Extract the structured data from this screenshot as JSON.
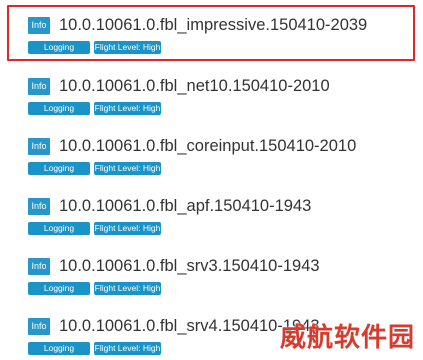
{
  "builds": [
    {
      "badge": "Info",
      "name": "10.0.10061.0.fbl_impressive.150410-2039",
      "tags": [
        "Logging",
        "Flight Level: High"
      ],
      "selected": true
    },
    {
      "badge": "Info",
      "name": "10.0.10061.0.fbl_net10.150410-2010",
      "tags": [
        "Logging",
        "Flight Level: High"
      ],
      "selected": false
    },
    {
      "badge": "Info",
      "name": "10.0.10061.0.fbl_coreinput.150410-2010",
      "tags": [
        "Logging",
        "Flight Level: High"
      ],
      "selected": false
    },
    {
      "badge": "Info",
      "name": "10.0.10061.0.fbl_apf.150410-1943",
      "tags": [
        "Logging",
        "Flight Level: High"
      ],
      "selected": false
    },
    {
      "badge": "Info",
      "name": "10.0.10061.0.fbl_srv3.150410-1943",
      "tags": [
        "Logging",
        "Flight Level: High"
      ],
      "selected": false
    },
    {
      "badge": "Info",
      "name": "10.0.10061.0.fbl_srv4.150410-1943",
      "tags": [
        "Logging",
        "Flight Level: High"
      ],
      "selected": false
    }
  ],
  "watermark": "威航软件园",
  "colors": {
    "badge": "#2796c9",
    "tag": "#1a93c7",
    "selection_border": "#e0262b",
    "text": "#333333",
    "watermark": "#d93a2e"
  }
}
